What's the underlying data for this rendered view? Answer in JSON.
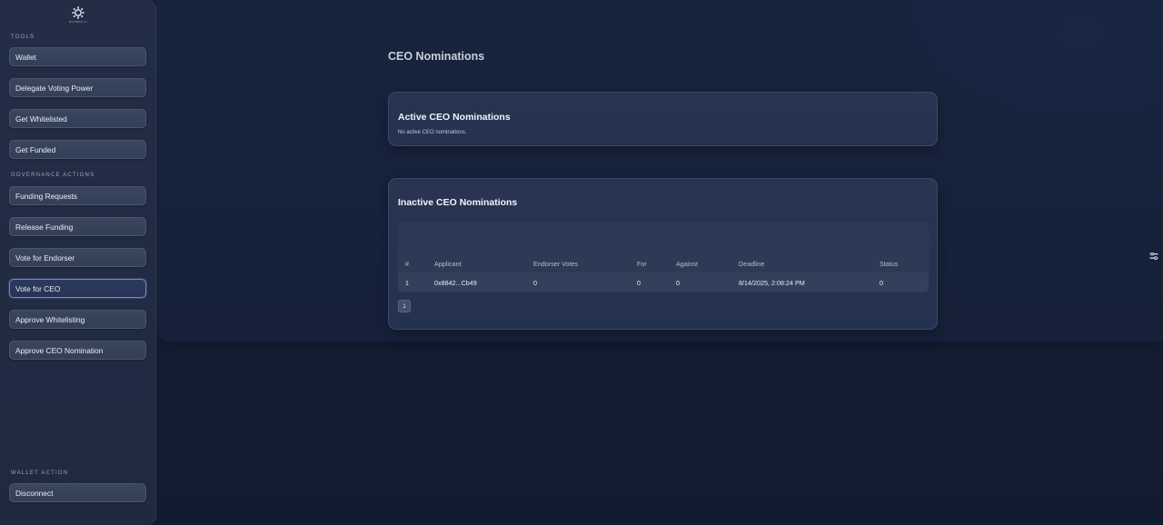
{
  "sidebar": {
    "logo_text": "BOTEBOT.AI",
    "sections": {
      "tools": "TOOLS",
      "governance": "GOVERNANCE ACTIONS",
      "wallet": "WALLET ACTION"
    },
    "tools": [
      "Wallet",
      "Delegate Voting Power",
      "Get Whitelisted",
      "Get Funded"
    ],
    "governance": [
      "Funding Requests",
      "Release Funding",
      "Vote for Endorser",
      "Vote for CEO",
      "Approve Whitelisting",
      "Approve CEO Nomination"
    ],
    "active_item": "Vote for CEO",
    "wallet_action": "Disconnect"
  },
  "main": {
    "title": "CEO Nominations",
    "active": {
      "title": "Active CEO Nominations",
      "empty_text": "No active CEO nominations."
    },
    "inactive": {
      "title": "Inactive CEO Nominations",
      "columns": [
        "#",
        "Applicant",
        "Endorser Votes",
        "For",
        "Against",
        "Deadline",
        "Status"
      ],
      "rows": [
        [
          "1",
          "0x8842...Cb49",
          "0",
          "0",
          "0",
          "8/14/2025, 2:08:24 PM",
          "0"
        ]
      ],
      "page": "1"
    }
  },
  "icons": {
    "logo": "gear-logo-icon",
    "floating": "toggle-settings-icon"
  },
  "colors": {
    "background": "#131c33",
    "sidebar": "#232e46",
    "card": "#283551",
    "active_border": "#6f88c9"
  }
}
